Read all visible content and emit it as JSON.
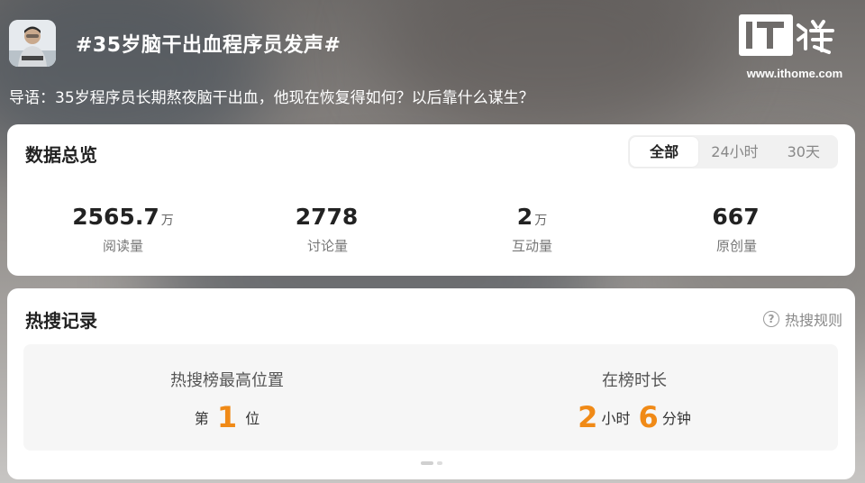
{
  "header": {
    "topic_title": "#35岁脑干出血程序员发声#",
    "lead": "导语：35岁程序员长期熬夜脑干出血，他现在恢复得如何？以后靠什么谋生？",
    "logo_text": "IT之家",
    "logo_url": "www.ithome.com"
  },
  "overview": {
    "title": "数据总览",
    "tabs": [
      {
        "label": "全部",
        "active": true
      },
      {
        "label": "24小时",
        "active": false
      },
      {
        "label": "30天",
        "active": false
      }
    ],
    "stats": [
      {
        "value": "2565.7",
        "unit": "万",
        "label": "阅读量"
      },
      {
        "value": "2778",
        "unit": "",
        "label": "讨论量"
      },
      {
        "value": "2",
        "unit": "万",
        "label": "互动量"
      },
      {
        "value": "667",
        "unit": "",
        "label": "原创量"
      }
    ]
  },
  "hot_search": {
    "title": "热搜记录",
    "rules_label": "热搜规则",
    "highest": {
      "title": "热搜榜最高位置",
      "prefix": "第",
      "number": "1",
      "suffix": "位"
    },
    "duration": {
      "title": "在榜时长",
      "hours": "2",
      "hours_unit": "小时",
      "minutes": "6",
      "minutes_unit": "分钟"
    }
  },
  "colors": {
    "accent": "#f08a17"
  }
}
